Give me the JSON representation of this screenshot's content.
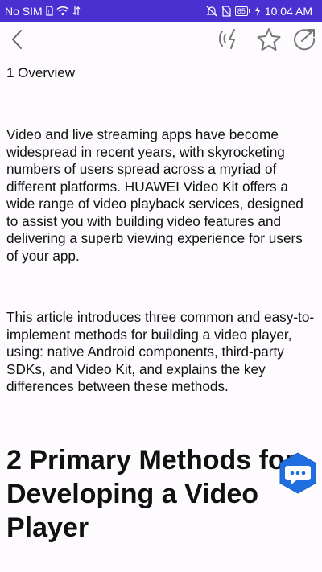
{
  "status_bar": {
    "carrier": "No SIM",
    "battery": "85",
    "time": "10:04 AM"
  },
  "toolbar": {
    "back_icon": "back-arrow-icon",
    "speak_icon": "text-to-speech-icon",
    "favorite_icon": "star-icon",
    "share_icon": "share-icon"
  },
  "article": {
    "section1_title": "1 Overview",
    "paragraph1": "Video and live streaming apps have become widespread in recent years, with skyrocketing numbers of users spread across a myriad of different platforms. HUAWEI Video Kit offers a wide range of video playback services, designed to assist you with building video features and delivering a superb viewing experience for users of your app.",
    "paragraph2": "This article introduces three common and easy-to-implement methods for building a video player, using: native Android components, third-party SDKs, and Video Kit, and explains the key differences between these methods.",
    "section2_title_line1": "2 Primary Methods for",
    "section2_title_line2": "Developing a Video",
    "section2_title_line3": "Player"
  },
  "colors": {
    "status_bar": "#4a2fd1",
    "fab": "#1f6fe0",
    "background": "#fdfbfe",
    "icon_gray": "#666666"
  },
  "fab": {
    "icon": "chat-bubble-icon"
  }
}
